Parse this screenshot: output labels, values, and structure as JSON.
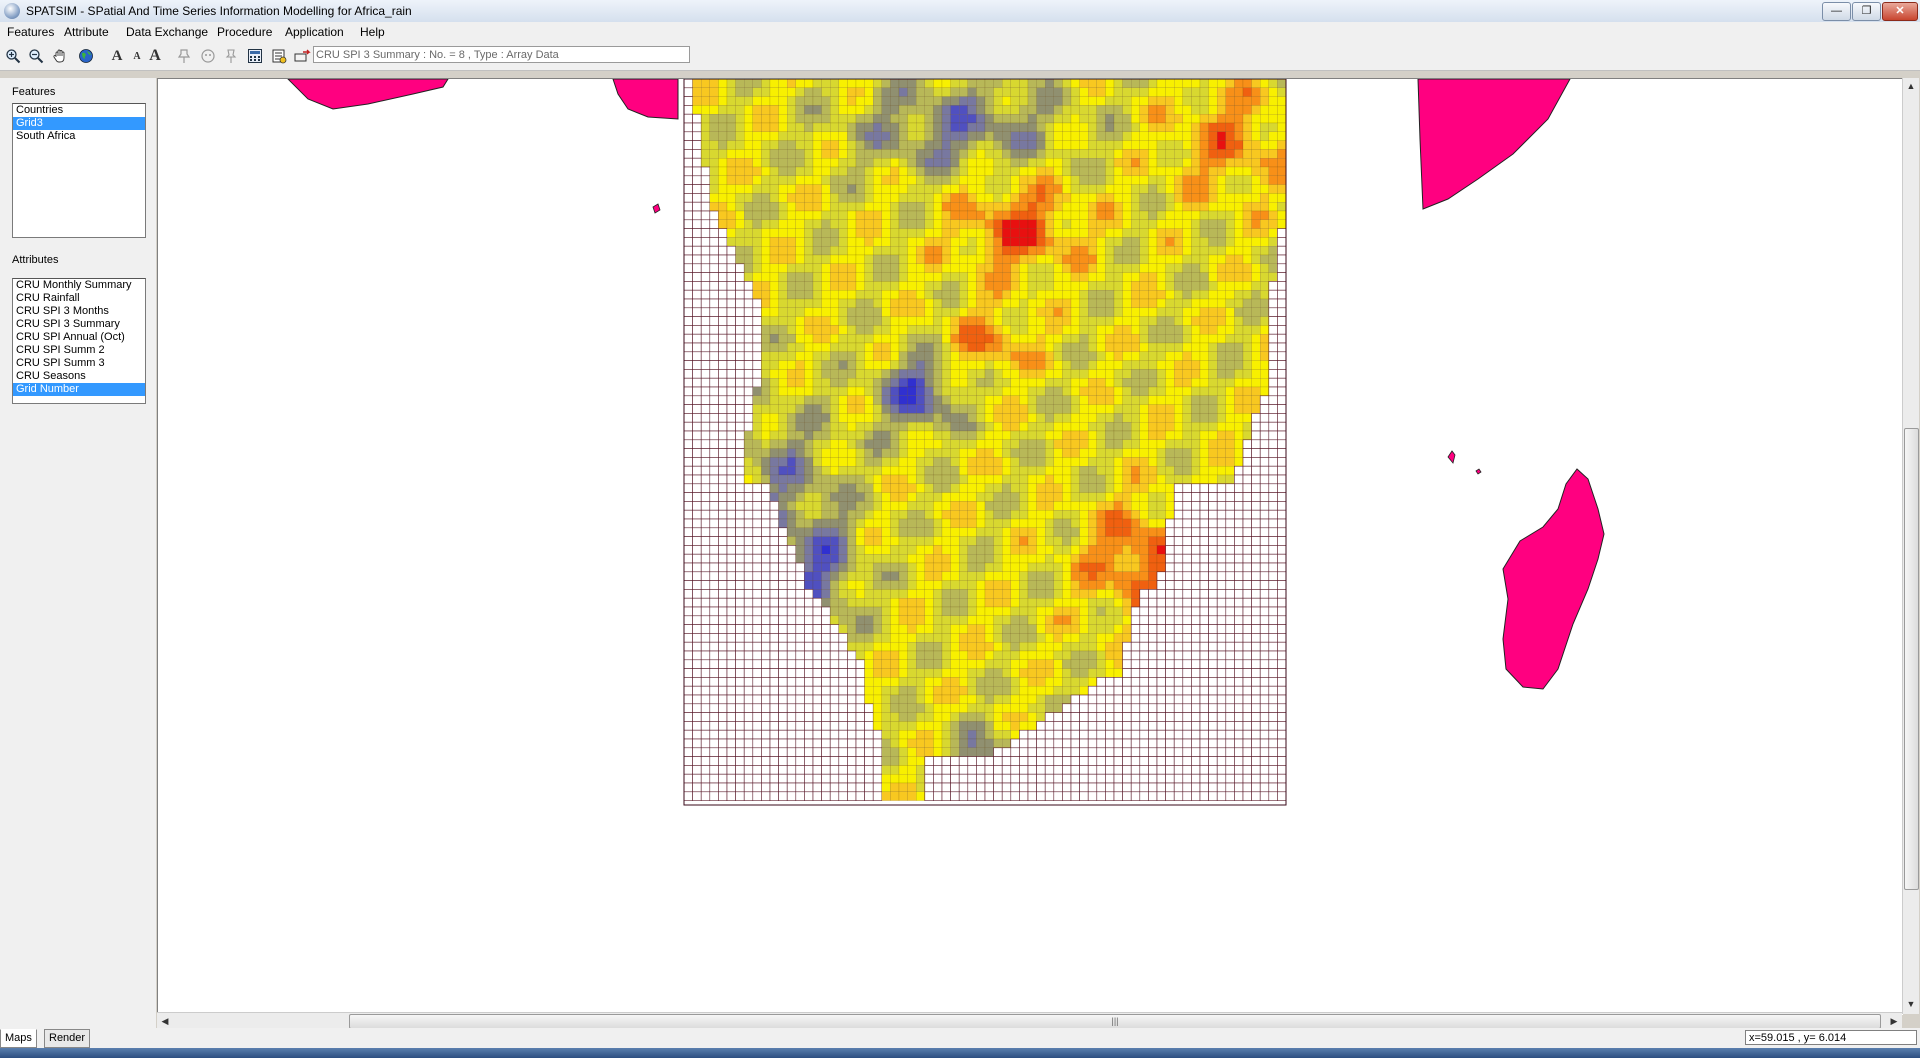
{
  "window": {
    "title": "SPATSIM - SPatial And Time Series Information Modelling for Africa_rain",
    "min_label": "—",
    "max_label": "❐",
    "close_label": "✕"
  },
  "menu": {
    "features": "Features",
    "attribute": "Attribute",
    "data_exchange": "Data Exchange",
    "procedure": "Procedure",
    "application": "Application",
    "help": "Help"
  },
  "toolbar": {
    "info_text": "CRU SPI 3 Summary : No. =   8 , Type  : Array Data",
    "font_labels": [
      "A",
      "A",
      "A"
    ]
  },
  "features_panel": {
    "label": "Features",
    "items": [
      {
        "label": "Countries",
        "selected": false
      },
      {
        "label": "Grid3",
        "selected": true
      },
      {
        "label": "South Africa",
        "selected": false
      }
    ]
  },
  "attributes_panel": {
    "label": "Attributes",
    "items": [
      {
        "label": "CRU Monthly Summary",
        "selected": false
      },
      {
        "label": "CRU Rainfall",
        "selected": false
      },
      {
        "label": "CRU SPI 3 Months",
        "selected": false
      },
      {
        "label": "CRU SPI 3 Summary",
        "selected": false
      },
      {
        "label": "CRU SPI Annual (Oct)",
        "selected": false
      },
      {
        "label": "CRU SPI Summ 2",
        "selected": false
      },
      {
        "label": "CRU SPI Summ 3",
        "selected": false
      },
      {
        "label": "CRU Seasons",
        "selected": false
      },
      {
        "label": "Grid Number",
        "selected": true
      }
    ]
  },
  "tabs": {
    "maps": "Maps",
    "render": "Render"
  },
  "status": {
    "coords": "x=59.015 , y= 6.014"
  },
  "colors": {
    "country_fill": "#ff0080",
    "grid_line": "#5a1a2a",
    "legend": [
      "#e81010",
      "#f06010",
      "#f89018",
      "#f8c820",
      "#f8f000",
      "#d8d830",
      "#b8b858",
      "#909070",
      "#7878a0",
      "#5050c0",
      "#3030d0"
    ]
  }
}
